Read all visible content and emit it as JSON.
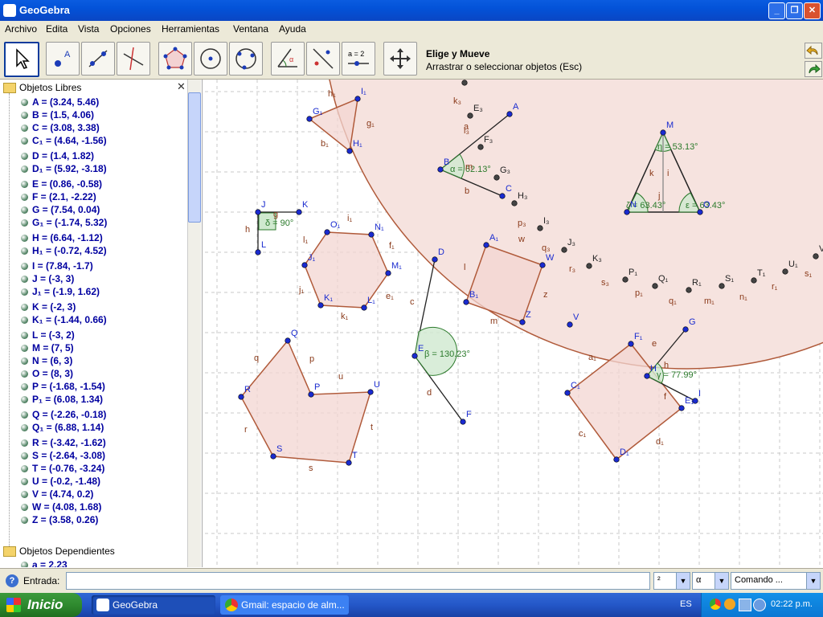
{
  "window": {
    "title": "GeoGebra"
  },
  "menu": [
    "Archivo",
    "Edita",
    "Vista",
    "Opciones",
    "Herramientas",
    "Ventana",
    "Ayuda"
  ],
  "tool_info": {
    "title": "Elige y Mueve",
    "description": "Arrastrar o seleccionar objetos (Esc)"
  },
  "tools": {
    "slider_label": "a = 2"
  },
  "algebra": {
    "free_folder": "Objetos Libres",
    "dependent_folder": "Objetos Dependientes",
    "objects": [
      "A = (3.24, 5.46)",
      "B = (1.5, 4.06)",
      "C = (3.08, 3.38)",
      "C₁ = (4.64, -1.56)",
      "D = (1.4, 1.82)",
      "D₁ = (5.92, -3.18)",
      "E = (0.86, -0.58)",
      "F = (2.1, -2.22)",
      "G = (7.54, 0.04)",
      "G₁ = (-1.74, 5.32)",
      "H = (6.64, -1.12)",
      "H₁ = (-0.72, 4.52)",
      "I = (7.84, -1.7)",
      "J = (-3, 3)",
      "J₁ = (-1.9, 1.62)",
      "K = (-2, 3)",
      "K₁ = (-1.44, 0.66)",
      "L = (-3, 2)",
      "M = (7, 5)",
      "N = (6, 3)",
      "O = (8, 3)",
      "P = (-1.68, -1.54)",
      "P₁ = (6.08, 1.34)",
      "Q = (-2.26, -0.18)",
      "Q₁ = (6.88, 1.14)",
      "R = (-3.42, -1.62)",
      "S = (-2.64, -3.08)",
      "T = (-0.76, -3.24)",
      "U = (-0.2, -1.48)",
      "V = (4.74, 0.2)",
      "W = (4.08, 1.68)",
      "Z = (3.58, 0.26)"
    ],
    "dependent_first": "a = 2.23"
  },
  "canvas": {
    "angles": {
      "alpha": "α = 62.13°",
      "beta": "β = 130.23°",
      "gamma": "γ = 77.99°",
      "delta": "δ = 90°",
      "eta": "η = 53.13°",
      "zeta": "ζ = 63.43°",
      "epsilon": "ε = 63.43°"
    }
  },
  "input": {
    "label": "Entrada:",
    "combo1": "²",
    "combo2": "α",
    "combo3": "Comando ..."
  },
  "taskbar": {
    "start": "Inicio",
    "tasks": [
      "GeoGebra",
      "Gmail: espacio de alm..."
    ],
    "lang": "ES",
    "time": "02:22 p.m."
  }
}
